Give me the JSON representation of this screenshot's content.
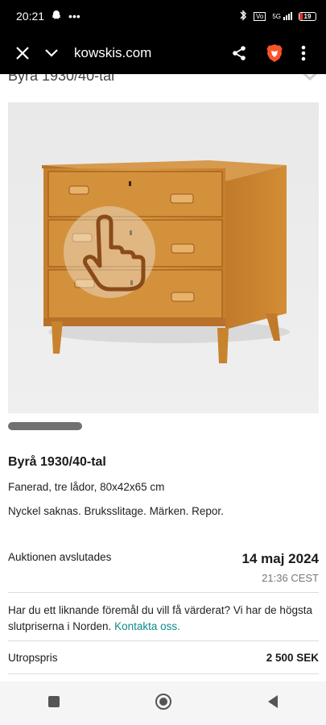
{
  "status": {
    "time": "20:21",
    "battery": "19",
    "network": "5G"
  },
  "browser": {
    "url": "kowskis.com"
  },
  "page": {
    "cut_title": "Byrå 1930/40-tal",
    "item_title": "Byrå 1930/40-tal",
    "desc1": "Fanerad, tre lådor, 80x42x65 cm",
    "desc2": "Nyckel saknas. Bruksslitage. Märken. Repor.",
    "auction_label": "Auktionen avslutades",
    "auction_date": "14 maj 2024",
    "auction_time": "21:36 CEST",
    "valuation_text": "Har du ett liknande föremål du vill få värderat? Vi har de högsta slutpriserna i Norden.",
    "contact_link": "Kontakta oss.",
    "price_label": "Utropspris",
    "price_value": "2 500 SEK"
  },
  "colors": {
    "accent": "#0e8a8a",
    "brave_orange": "#fb542b"
  }
}
